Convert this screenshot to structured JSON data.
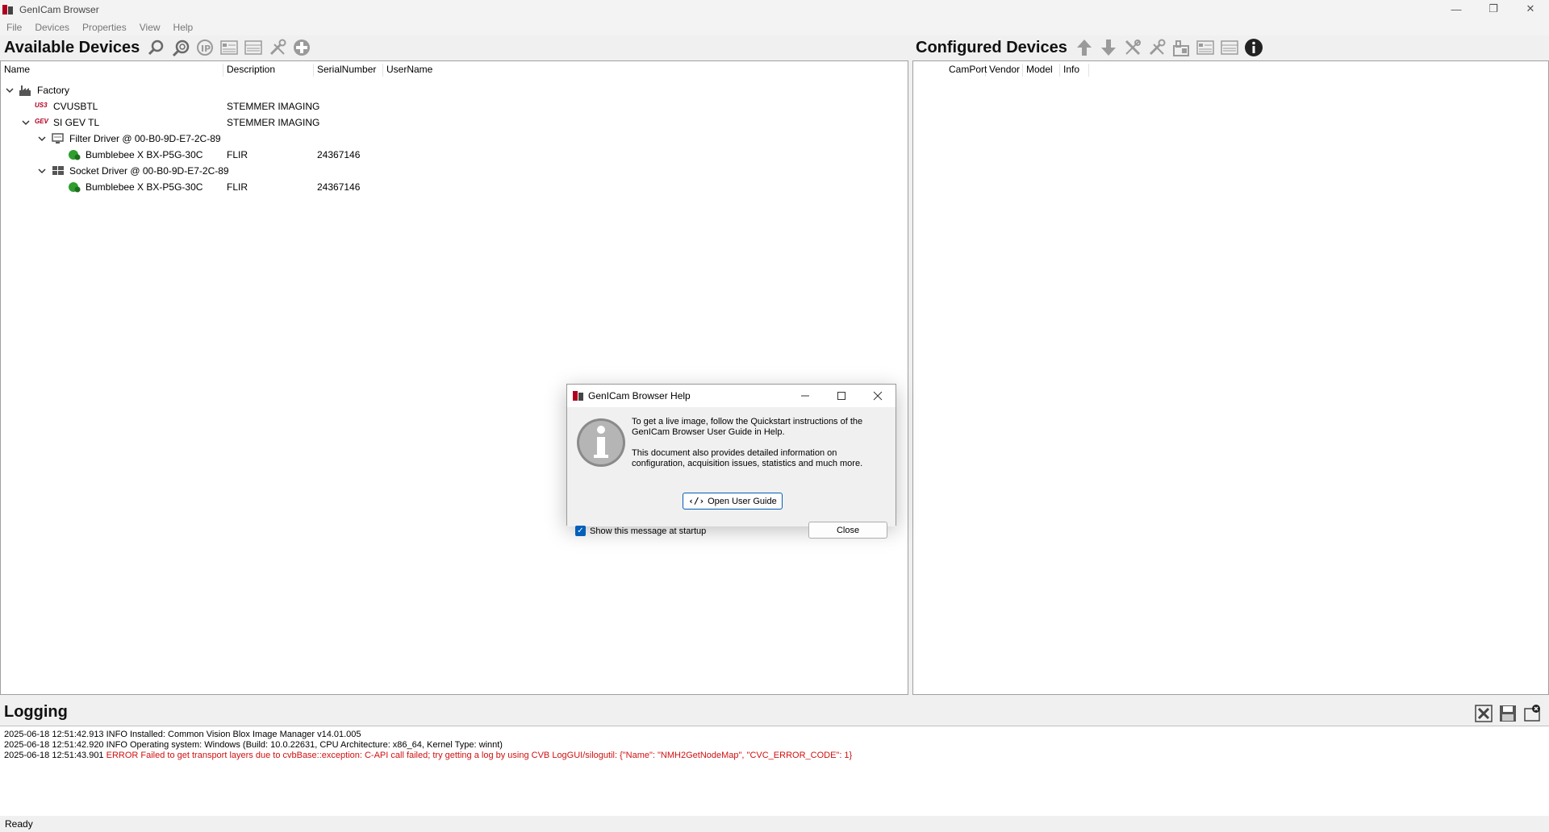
{
  "window": {
    "title": "GenICam Browser",
    "min": "—",
    "max": "❐",
    "close": "✕"
  },
  "menu": [
    "File",
    "Devices",
    "Properties",
    "View",
    "Help"
  ],
  "available": {
    "title": "Available Devices",
    "columns": [
      "Name",
      "Description",
      "SerialNumber",
      "UserName"
    ],
    "rows": [
      {
        "name": "Factory",
        "desc": "",
        "serial": ""
      },
      {
        "name": "CVUSBTL",
        "desc": "STEMMER IMAGING",
        "serial": ""
      },
      {
        "name": "SI GEV TL",
        "desc": "STEMMER IMAGING",
        "serial": ""
      },
      {
        "name": "Filter Driver @ 00-B0-9D-E7-2C-89",
        "desc": "",
        "serial": ""
      },
      {
        "name": "Bumblebee X BX-P5G-30C",
        "desc": "FLIR",
        "serial": "24367146"
      },
      {
        "name": "Socket Driver @ 00-B0-9D-E7-2C-89",
        "desc": "",
        "serial": ""
      },
      {
        "name": "Bumblebee X BX-P5G-30C",
        "desc": "FLIR",
        "serial": "24367146"
      }
    ],
    "icon_labels": {
      "usb": "US3",
      "gev": "GEV"
    }
  },
  "configured": {
    "title": "Configured Devices",
    "columns": [
      "CamPort",
      "Vendor",
      "Model",
      "Info"
    ]
  },
  "logging": {
    "title": "Logging",
    "lines": [
      {
        "prefix": "2025-06-18 12:51:42.913 INFO Installed: Common Vision Blox Image Manager v14.01.005",
        "error": ""
      },
      {
        "prefix": "2025-06-18 12:51:42.920 INFO Operating system: Windows (Build: 10.0.22631, CPU Architecture: x86_64, Kernel Type: winnt)",
        "error": ""
      },
      {
        "prefix": "2025-06-18 12:51:43.901 ",
        "error": "ERROR Failed to get transport layers due to cvbBase::exception: C-API call failed; try getting a log by using CVB LogGUI/silogutil: {\"Name\": \"NMH2GetNodeMap\", \"CVC_ERROR_CODE\": 1}"
      }
    ]
  },
  "status": "Ready",
  "dialog": {
    "title": "GenICam Browser Help",
    "para1": "To get a live image, follow the Quickstart instructions of the GenICam Browser User Guide in Help.",
    "para2": "This document also provides detailed information on configuration, acquisition issues, statistics and much more.",
    "open_guide": "Open User Guide",
    "close": "Close",
    "show_startup": "Show this message at startup"
  },
  "colors": {
    "accent": "#005fb8",
    "error": "#d01010",
    "icon_grey": "#6a6a6a",
    "device_green": "#2e9e2e"
  }
}
